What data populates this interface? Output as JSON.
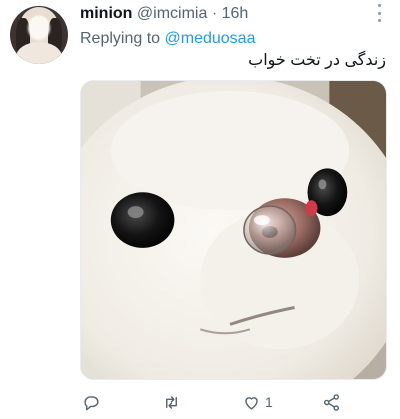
{
  "tweet": {
    "author_name": "minion",
    "handle": "@imcimia",
    "separator": "·",
    "time": "16h",
    "replying_prefix": "Replying to",
    "replying_to": "@meduosaa",
    "text": "زندگی در تخت خواب",
    "like_count": "1"
  },
  "colors": {
    "accent": "#1d9bf0",
    "secondary_text": "#536471",
    "primary_text": "#0f1419"
  },
  "icons": {
    "reply": "reply-icon",
    "retweet": "retweet-icon",
    "like": "heart-icon",
    "share": "share-icon",
    "more": "more-icon"
  }
}
